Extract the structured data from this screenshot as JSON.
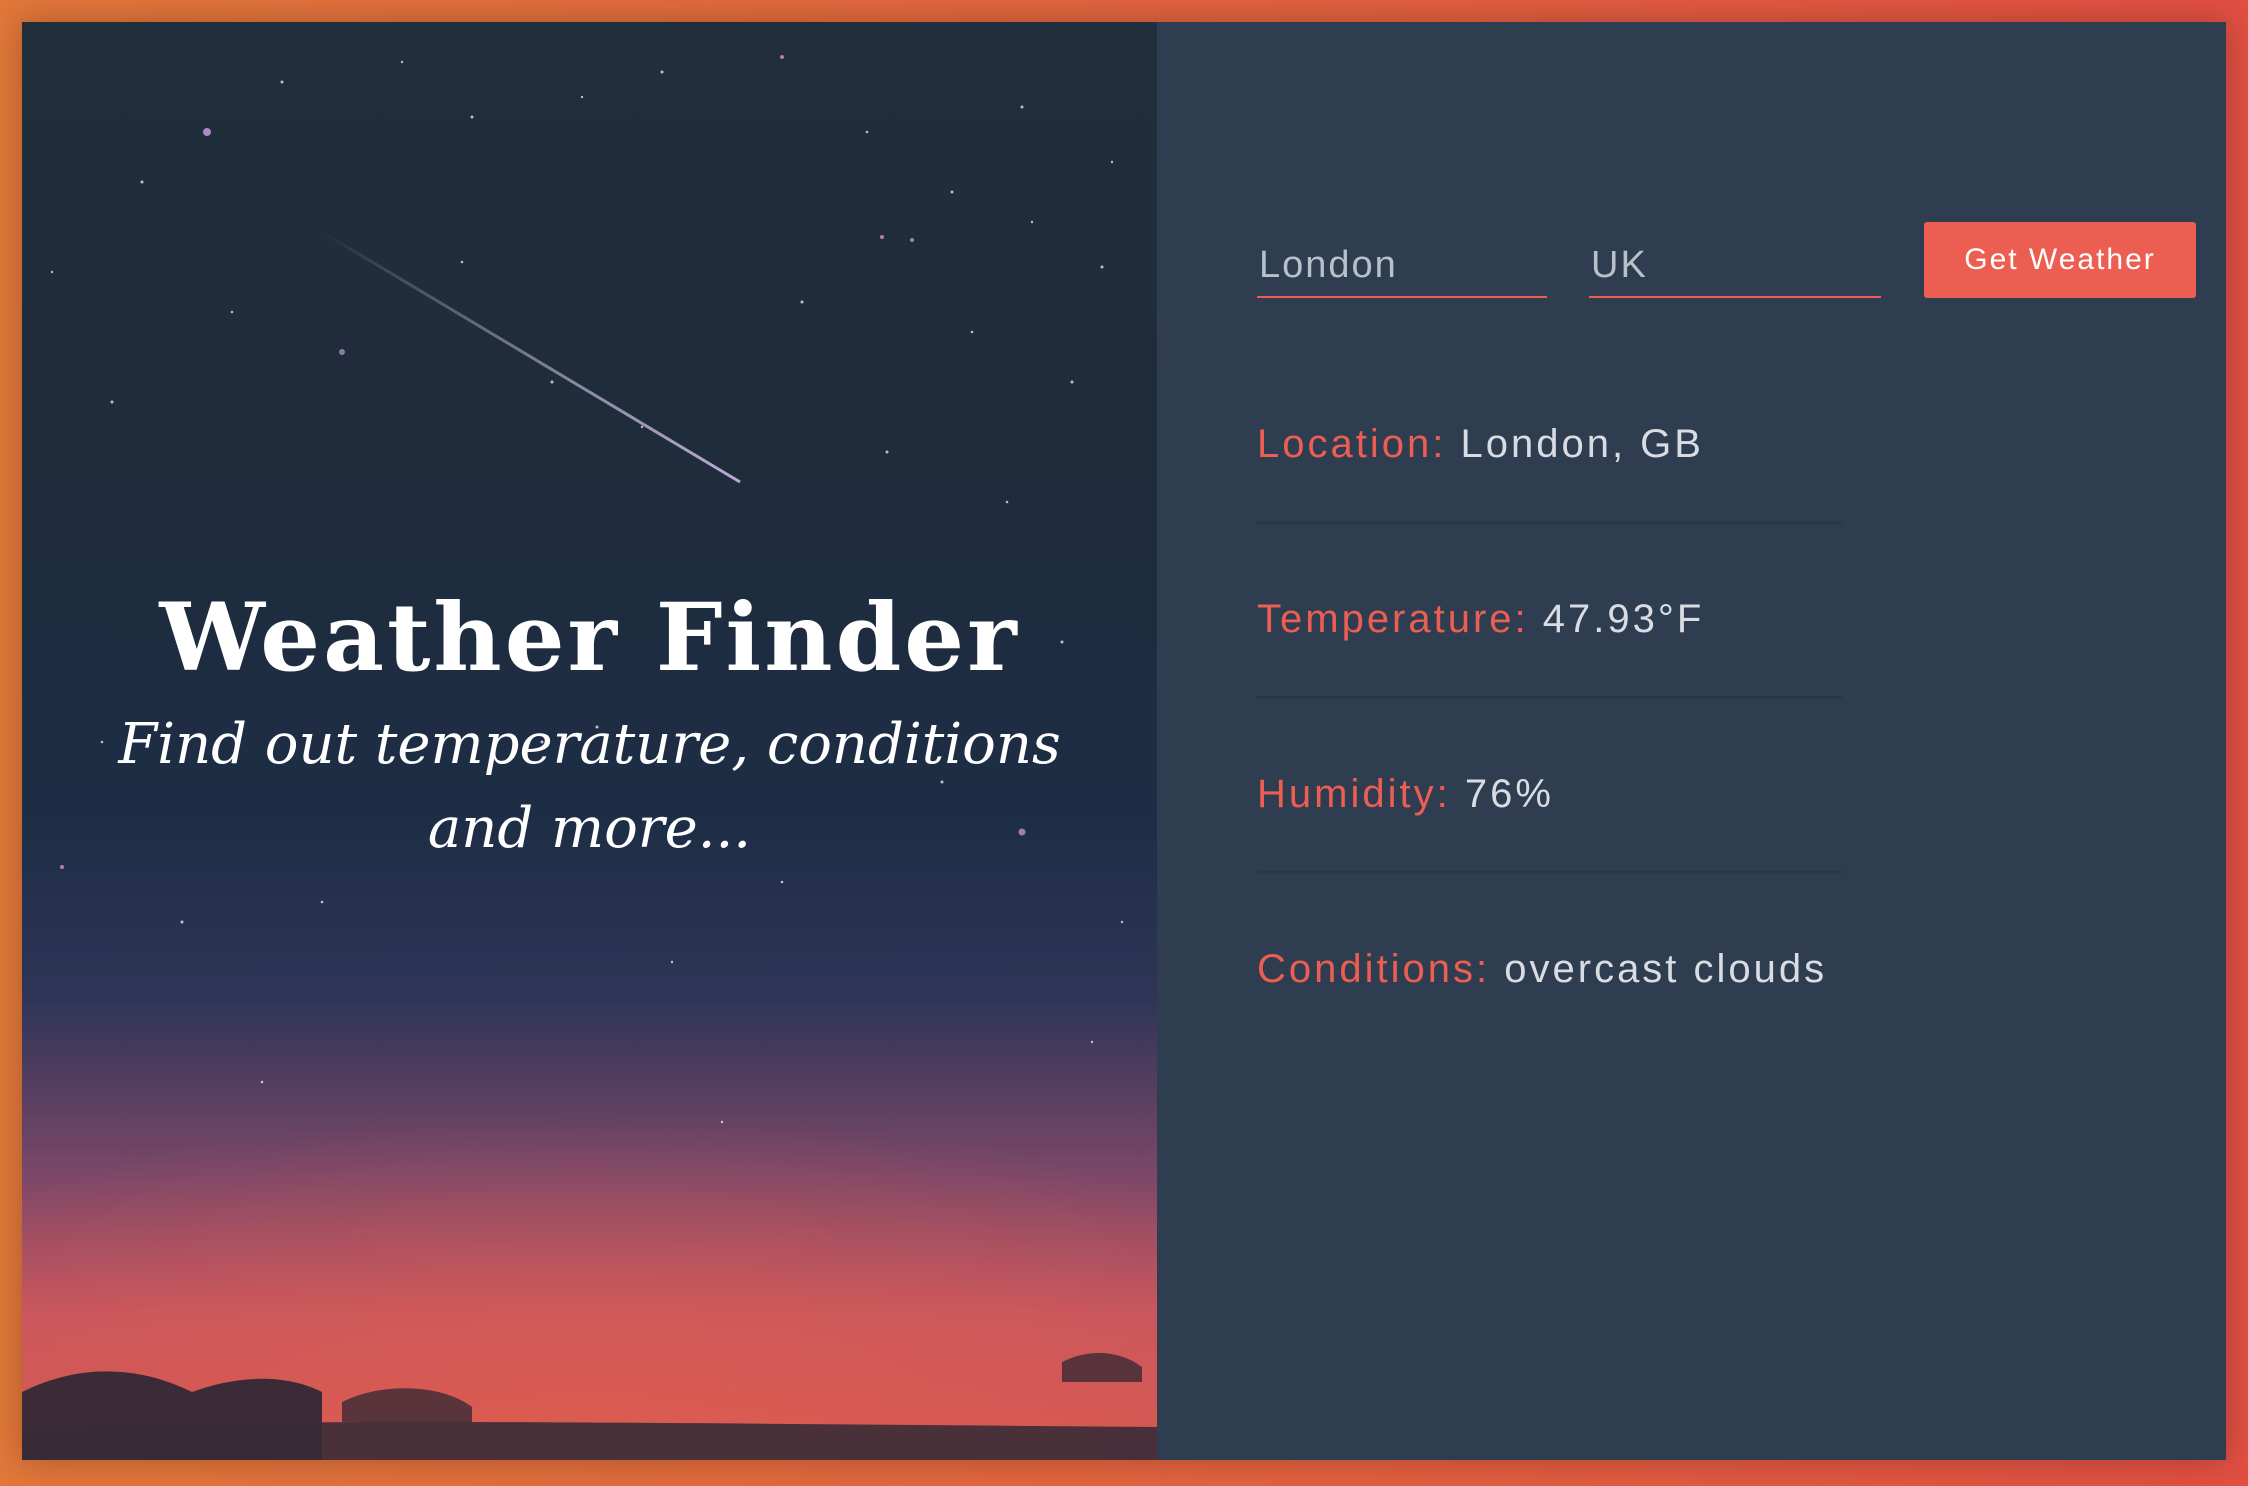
{
  "hero": {
    "title": "Weather Finder",
    "subtitle": "Find out temperature, conditions and more..."
  },
  "form": {
    "city_placeholder": "London",
    "country_placeholder": "UK",
    "submit_label": "Get Weather"
  },
  "weather": {
    "location_label": "Location:",
    "location_value": "London, GB",
    "temperature_label": "Temperature:",
    "temperature_value": "47.93°F",
    "humidity_label": "Humidity:",
    "humidity_value": "76%",
    "conditions_label": "Conditions:",
    "conditions_value": "overcast clouds"
  },
  "colors": {
    "accent": "#ec5e52",
    "panel_bg": "#2e3d50",
    "frame_gradient_start": "#e1773a",
    "frame_gradient_end": "#e14f42"
  }
}
